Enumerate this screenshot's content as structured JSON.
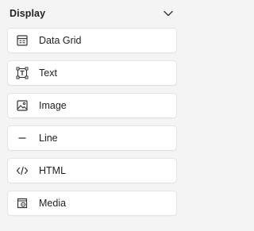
{
  "section": {
    "title": "Display",
    "collapse_icon": "chevron-down-icon"
  },
  "items": [
    {
      "label": "Data Grid",
      "icon": "data-grid-icon"
    },
    {
      "label": "Text",
      "icon": "text-icon"
    },
    {
      "label": "Image",
      "icon": "image-icon"
    },
    {
      "label": "Line",
      "icon": "line-icon"
    },
    {
      "label": "HTML",
      "icon": "code-icon"
    },
    {
      "label": "Media",
      "icon": "media-icon"
    }
  ],
  "colors": {
    "background": "#f4f4f4",
    "card": "#ffffff",
    "text": "#222222",
    "icon": "#333333"
  }
}
